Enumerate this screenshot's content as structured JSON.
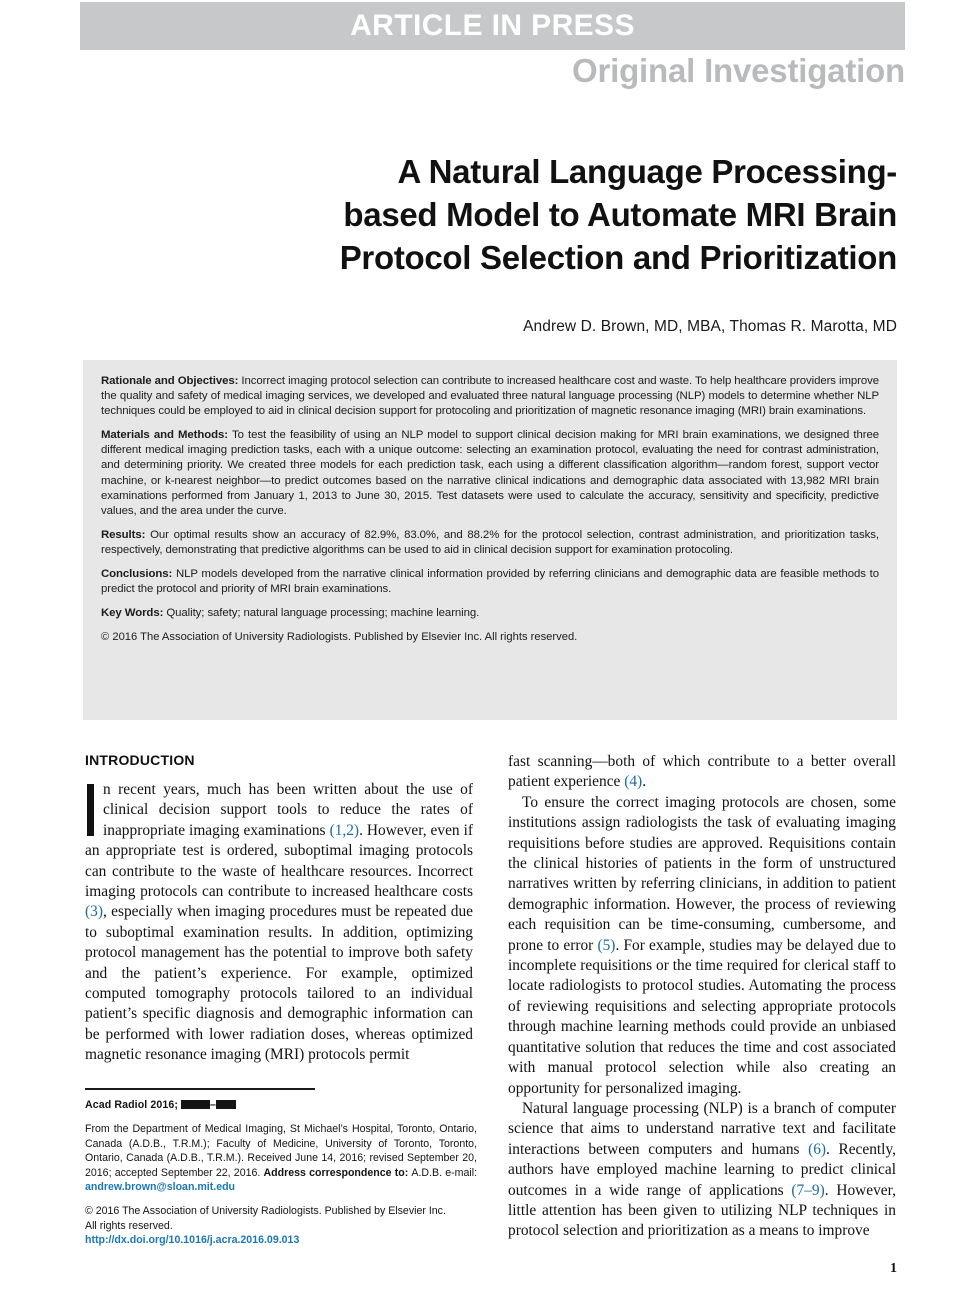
{
  "header": {
    "press_banner": "ARTICLE IN PRESS",
    "section_label": "Original Investigation",
    "banner_bg": "#c6c8ca",
    "section_color": "#b8babc"
  },
  "title": {
    "line1": "A Natural Language Processing-",
    "line2": "based Model to Automate MRI Brain",
    "line3": "Protocol Selection and Prioritization",
    "authors": "Andrew D. Brown, MD, MBA, Thomas R. Marotta, MD"
  },
  "abstract": {
    "bg": "#e7e7e7",
    "sections": [
      {
        "lead": "Rationale and Objectives:",
        "body": " Incorrect imaging protocol selection can contribute to increased healthcare cost and waste. To help healthcare providers improve the quality and safety of medical imaging services, we developed and evaluated three natural language processing (NLP) models to determine whether NLP techniques could be employed to aid in clinical decision support for protocoling and prioritization of magnetic resonance imaging (MRI) brain examinations."
      },
      {
        "lead": "Materials and Methods:",
        "body": " To test the feasibility of using an NLP model to support clinical decision making for MRI brain examinations, we designed three different medical imaging prediction tasks, each with a unique outcome: selecting an examination protocol, evaluating the need for contrast administration, and determining priority. We created three models for each prediction task, each using a different classification algorithm—random forest, support vector machine, or k-nearest neighbor—to predict outcomes based on the narrative clinical indications and demographic data associated with 13,982 MRI brain examinations performed from January 1, 2013 to June 30, 2015. Test datasets were used to calculate the accuracy, sensitivity and specificity, predictive values, and the area under the curve."
      },
      {
        "lead": "Results:",
        "body": " Our optimal results show an accuracy of 82.9%, 83.0%, and 88.2% for the protocol selection, contrast administration, and prioritization tasks, respectively, demonstrating that predictive algorithms can be used to aid in clinical decision support for examination protocoling."
      },
      {
        "lead": "Conclusions:",
        "body": " NLP models developed from the narrative clinical information provided by referring clinicians and demographic data are feasible methods to predict the protocol and priority of MRI brain examinations."
      },
      {
        "lead": "Key Words:",
        "body": " Quality; safety; natural language processing; machine learning."
      }
    ],
    "copyright": "© 2016 The Association of University Radiologists. Published by Elsevier Inc. All rights reserved."
  },
  "body": {
    "left_heading": "INTRODUCTION",
    "left_para1_first": "n recent years, much has been written about the use of clinical decision support tools to reduce the rates of inappropriate imaging examinations ",
    "left_para1_ref": "(1,2)",
    "left_para1_mid": ". However, even if an appropriate test is ordered, suboptimal imaging protocols can contribute to the waste of healthcare resources. Incorrect imaging protocols can contribute to increased healthcare costs ",
    "left_para1_ref2": "(3)",
    "left_para1_end": ", especially when imaging procedures must be repeated due to suboptimal examination results. In addition, optimizing protocol management has the potential to improve both safety and the patient’s experience. For example, optimized computed tomography protocols tailored to an individual patient’s specific diagnosis and demographic information can be performed with lower radiation doses, whereas optimized magnetic resonance imaging (MRI) protocols permit",
    "right_para1_start": "fast scanning—both of which contribute to a better overall patient experience ",
    "right_para1_ref": "(4)",
    "right_para1_end": ".",
    "right_para2_start": "To ensure the correct imaging protocols are chosen, some institutions assign radiologists the task of evaluating imaging requisitions before studies are approved. Requisitions contain the clinical histories of patients in the form of unstructured narratives written by referring clinicians, in addition to patient demographic information. However, the process of reviewing each requisition can be time-consuming, cumbersome, and prone to error ",
    "right_para2_ref": "(5)",
    "right_para2_end": ". For example, studies may be delayed due to incomplete requisitions or the time required for clerical staff to locate radiologists to protocol studies. Automating the process of reviewing requisitions and selecting appropriate protocols through machine learning methods could provide an unbiased quantitative solution that reduces the time and cost associated with manual protocol selection while also creating an opportunity for personalized imaging.",
    "right_para3_start": "Natural language processing (NLP) is a branch of computer science that aims to understand narrative text and facilitate interactions between computers and humans ",
    "right_para3_ref": "(6)",
    "right_para3_mid": ". Recently, authors have employed machine learning to predict clinical outcomes in a wide range of applications ",
    "right_para3_ref2": "(7–9)",
    "right_para3_end": ". However, little attention has been given to utilizing NLP techniques in protocol selection and prioritization as a means to improve",
    "reference_link_color": "#1b6c9c"
  },
  "footnote": {
    "citation_prefix": "Acad Radiol 2016;",
    "affiliation_1": "From the Department of Medical Imaging, St Michael’s Hospital, Toronto, Ontario, Canada (A.D.B., T.R.M.); Faculty of Medicine, University of Toronto, Toronto, Ontario, Canada (A.D.B., T.R.M.). Received June 14, 2016; revised September 20, 2016; accepted September 22, 2016. ",
    "affiliation_bold": "Address correspondence to: ",
    "affiliation_tail": "A.D.B.  e-mail: ",
    "email": "andrew.brown@sloan.mit.edu",
    "copyright_line1": "© 2016 The Association of University Radiologists. Published by Elsevier Inc.",
    "copyright_line2": "All rights reserved.",
    "doi": "http://dx.doi.org/10.1016/j.acra.2016.09.013",
    "link_color": "#1b78b8"
  },
  "page_number": "1"
}
